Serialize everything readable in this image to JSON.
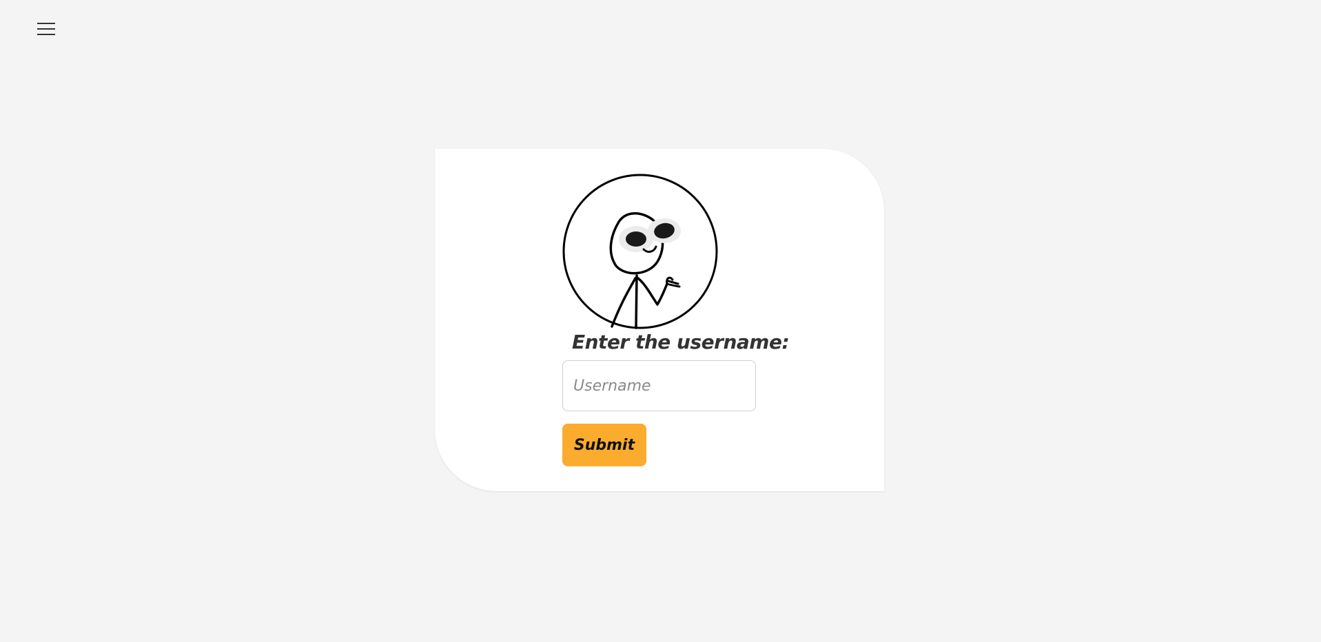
{
  "nav": {
    "menu_icon": "hamburger-icon"
  },
  "form": {
    "avatar_icon": "stick-figure-sunglasses-avatar",
    "label": "Enter the username:",
    "username_placeholder": "Username",
    "username_value": "",
    "submit_label": "Submit"
  },
  "colors": {
    "page_background": "#f4f4f4",
    "card_background": "#ffffff",
    "accent": "#fbab2e",
    "text": "#333333"
  }
}
